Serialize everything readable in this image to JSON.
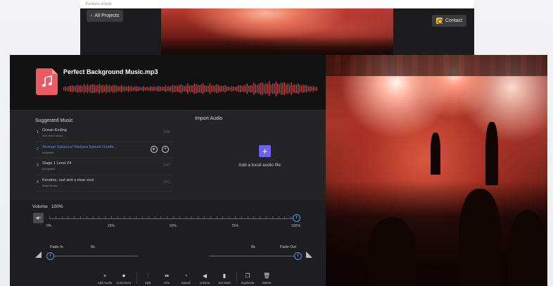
{
  "back_window": {
    "top_text": "Fantastic project",
    "all_projects_label": "All Projects",
    "contact_label": "Contact"
  },
  "editor": {
    "file_title": "Perfect Background Music.mp3",
    "suggested_title": "Suggested Music",
    "import_title": "Import Audio",
    "add_local_label": "Add a local audio file",
    "tracks": [
      {
        "num": "1",
        "name": "Ocean Ending",
        "artist": "Soft and Furious",
        "duration": "3:00"
      },
      {
        "num": "2",
        "name": "Strange Galactus/ Barbara Epeule Giraffe...",
        "artist": "Nickelbot",
        "duration": ""
      },
      {
        "num": "3",
        "name": "Stage 1 Level 24",
        "artist": "Monplaisir",
        "duration": "3:47"
      },
      {
        "num": "4",
        "name": "Keratine, rust and a clear soul",
        "artist": "Alalia Audan",
        "duration": "3:01"
      }
    ],
    "volume": {
      "label": "Volume",
      "value_label": "100%",
      "level": 1.0,
      "marks": [
        "0%",
        "25%",
        "50%",
        "75%",
        "100%"
      ]
    },
    "fade_in": {
      "label": "Fade In",
      "value": "0s"
    },
    "fade_out": {
      "label": "Fade Out",
      "value": "0s"
    },
    "toolbar": [
      {
        "icon": "plus-icon",
        "label": "Add Audio"
      },
      {
        "icon": "mic-icon",
        "label": "VoiceOver"
      },
      {
        "icon": "split-icon",
        "label": "Split"
      },
      {
        "icon": "trim-icon",
        "label": "Trim"
      },
      {
        "icon": "speed-icon",
        "label": "Speed"
      },
      {
        "icon": "volume-icon",
        "label": "Volume"
      },
      {
        "icon": "set-start-icon",
        "label": "Set Start"
      },
      {
        "icon": "duplicate-icon",
        "label": "Duplicate"
      },
      {
        "icon": "trash-icon",
        "label": "Delete"
      }
    ]
  },
  "colors": {
    "accent": "#5b8fe8",
    "file_tile": "#ec5a63",
    "add_button": "#6a62f0",
    "waveform": "#c0454a"
  }
}
